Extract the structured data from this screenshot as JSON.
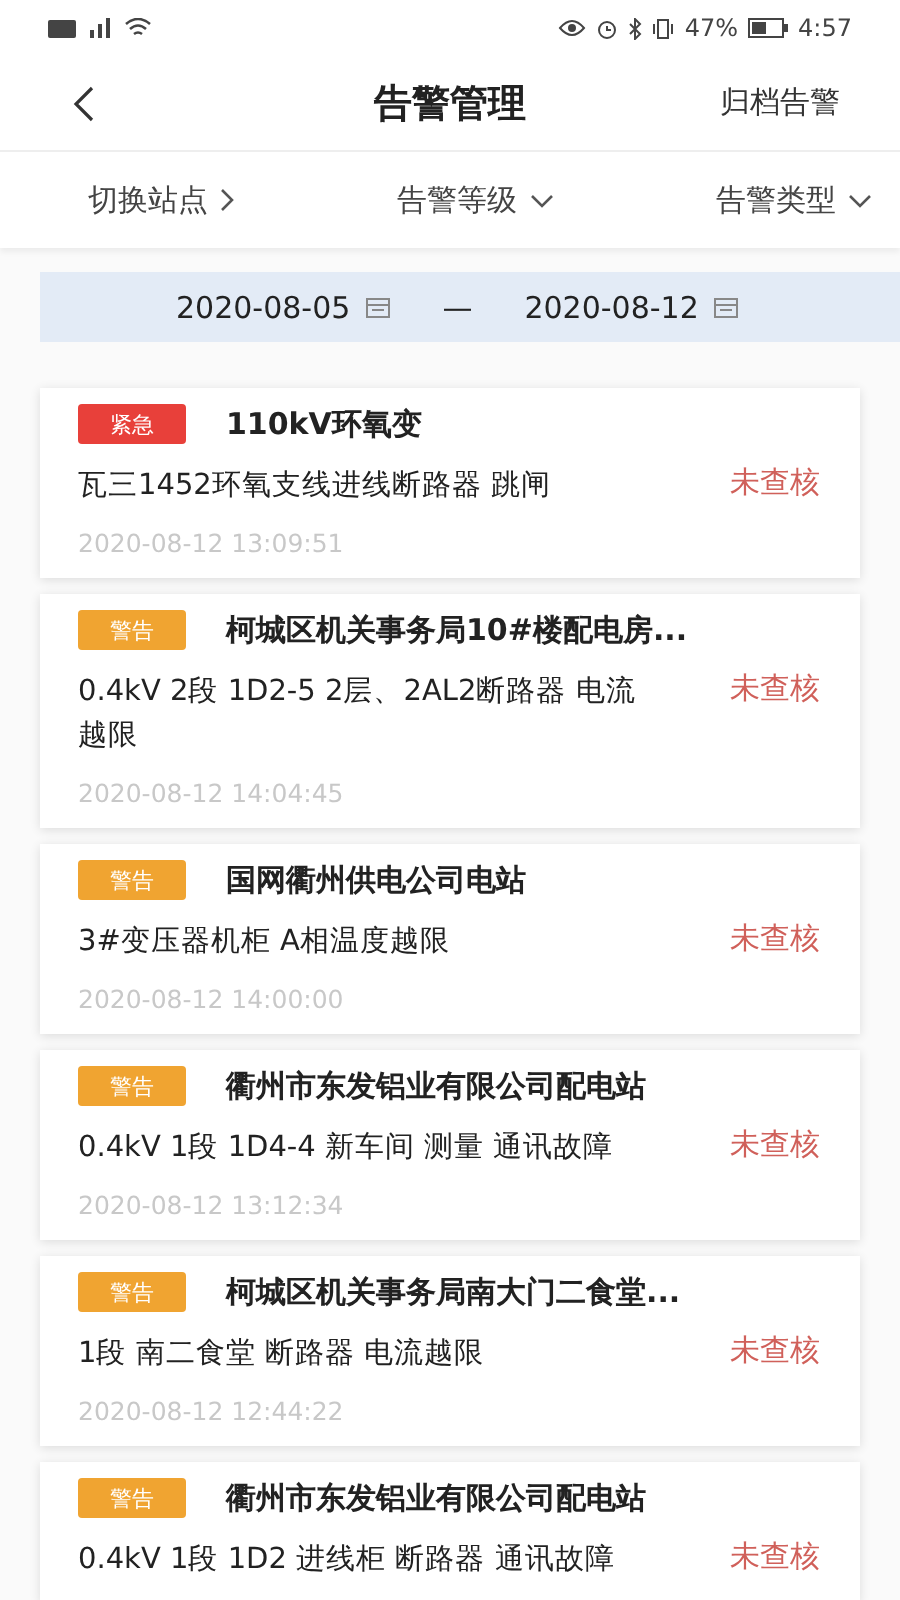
{
  "status_bar": {
    "battery": "47%",
    "time": "4:57"
  },
  "header": {
    "title": "告警管理",
    "action": "归档告警"
  },
  "filters": [
    {
      "label": "切换站点",
      "kind": "link"
    },
    {
      "label": "告警等级",
      "kind": "dropdown"
    },
    {
      "label": "告警类型",
      "kind": "dropdown"
    }
  ],
  "date_range": {
    "start": "2020-08-05",
    "separator": "—",
    "end": "2020-08-12"
  },
  "alarms": [
    {
      "level": "紧急",
      "color": "#e8403a",
      "title": "110kV环氧变",
      "description": "瓦三1452环氧支线进线断路器 跳闸",
      "status": "未查核",
      "time": "2020-08-12 13:09:51"
    },
    {
      "level": "警告",
      "color": "#f0a431",
      "title": "柯城区机关事务局10#楼配电房...",
      "description": "0.4kV 2段 1D2-5 2层、2AL2断路器 电流越限",
      "status": "未查核",
      "time": "2020-08-12 14:04:45"
    },
    {
      "level": "警告",
      "color": "#f0a431",
      "title": "国网衢州供电公司电站",
      "description": "3#变压器机柜 A相温度越限",
      "status": "未查核",
      "time": "2020-08-12 14:00:00"
    },
    {
      "level": "警告",
      "color": "#f0a431",
      "title": "衢州市东发铝业有限公司配电站",
      "description": "0.4kV 1段 1D4-4 新车间 测量 通讯故障",
      "status": "未查核",
      "time": "2020-08-12 13:12:34"
    },
    {
      "level": "警告",
      "color": "#f0a431",
      "title": "柯城区机关事务局南大门二食堂...",
      "description": "1段  南二食堂 断路器 电流越限",
      "status": "未查核",
      "time": "2020-08-12 12:44:22"
    },
    {
      "level": "警告",
      "color": "#f0a431",
      "title": "衢州市东发铝业有限公司配电站",
      "description": "0.4kV 1段 1D2 进线柜 断路器 通讯故障",
      "status": "未查核"
    }
  ]
}
